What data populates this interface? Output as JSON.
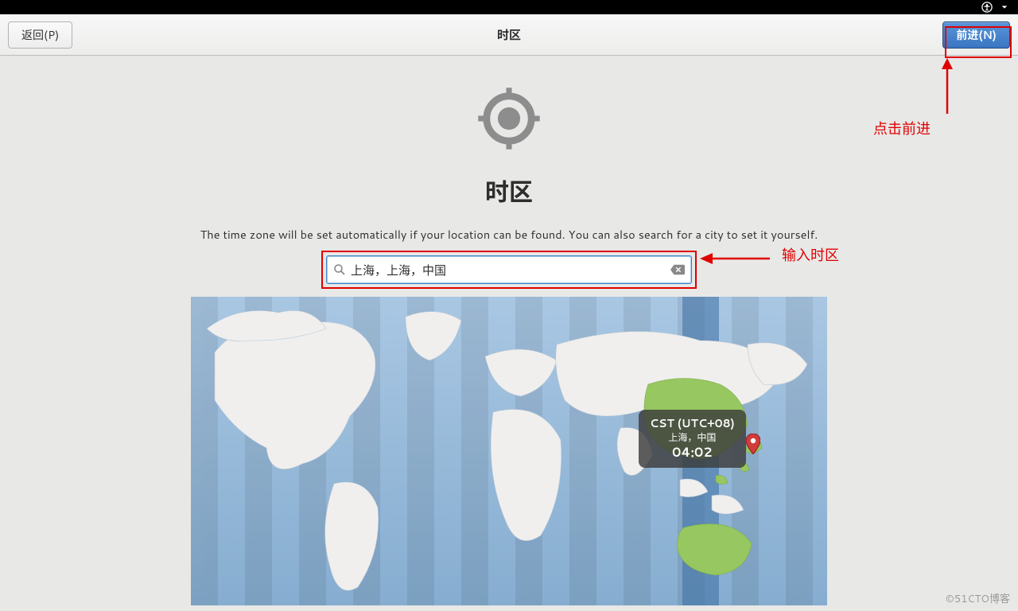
{
  "toppanel": {},
  "header": {
    "back_label": "返回(P)",
    "title": "时区",
    "forward_label": "前进(N)"
  },
  "page": {
    "big_title": "时区",
    "subtitle": "The time zone will be set automatically if your location can be found. You can also search for a city to set it yourself."
  },
  "search": {
    "value": "上海，上海，中国",
    "placeholder": ""
  },
  "map": {
    "bubble_timezone": "CST (UTC+08)",
    "bubble_location": "上海，中国",
    "bubble_time": "04:02"
  },
  "annotations": {
    "click_forward": "点击前进",
    "input_timezone": "输入时区"
  },
  "watermark": "©51CTO博客"
}
